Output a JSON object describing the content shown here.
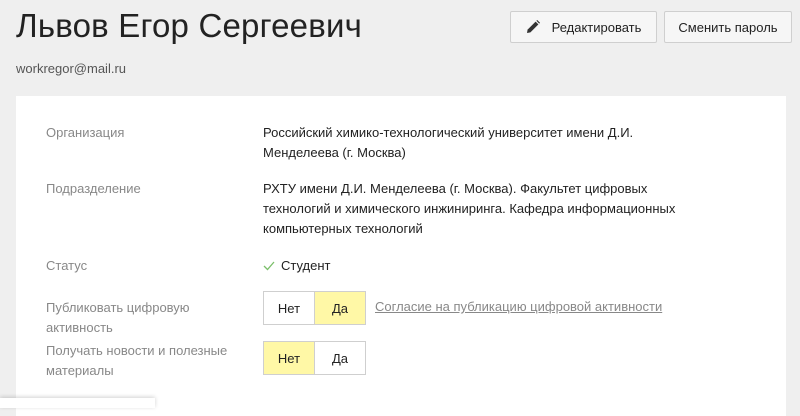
{
  "profile": {
    "name": "Львов Егор Сергеевич",
    "email": "workregor@mail.ru"
  },
  "actions": {
    "edit_label": "Редактировать",
    "change_password_label": "Сменить пароль"
  },
  "details": {
    "organization": {
      "label": "Организация",
      "value_line1": "Российский химико-технологический университет имени Д.И.",
      "value_line2": "Менделеева (г. Москва)"
    },
    "department": {
      "label": "Подразделение",
      "value_line1": "РХТУ имени Д.И. Менделеева (г. Москва). Факультет цифровых",
      "value_line2": "технологий и химического инжиниринга. Кафедра информационных",
      "value_line3": "компьютерных технологий"
    },
    "status": {
      "label": "Статус",
      "value": "Студент",
      "icon": "check-icon",
      "icon_color": "#7bbf6a"
    },
    "publish_activity": {
      "label": "Публиковать цифровую активность",
      "options": [
        "Нет",
        "Да"
      ],
      "selected": "Да",
      "link": "Согласие на публикацию цифровой активности"
    },
    "receive_news": {
      "label_line1": "Получать новости и полезные",
      "label_line2": "материалы",
      "options": [
        "Нет",
        "Да"
      ],
      "selected": "Нет"
    }
  },
  "colors": {
    "background": "#efefef",
    "card": "#ffffff",
    "toggle_active": "#fff8a6"
  }
}
